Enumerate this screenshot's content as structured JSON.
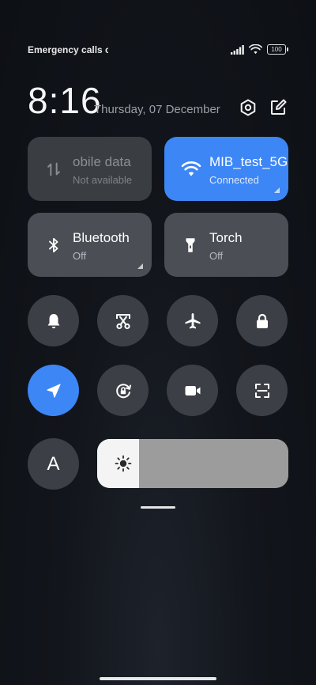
{
  "status_bar": {
    "carrier_text": "Emergency calls o",
    "battery_level": "100"
  },
  "header": {
    "time": "8:16",
    "date": "Thursday, 07 December"
  },
  "tiles": {
    "mobile_data": {
      "title": "obile data",
      "subtitle": "Not available",
      "active": false,
      "available": false
    },
    "wifi": {
      "title": "MIB_test_5G",
      "subtitle": "Connected",
      "active": true
    },
    "bluetooth": {
      "title": "Bluetooth",
      "subtitle": "Off",
      "active": false
    },
    "torch": {
      "title": "Torch",
      "subtitle": "Off",
      "active": false
    }
  },
  "toggles": [
    {
      "name": "notification-bell",
      "icon": "bell-icon",
      "active": false
    },
    {
      "name": "screenshot",
      "icon": "scissors-screenshot-icon",
      "active": false
    },
    {
      "name": "airplane-mode",
      "icon": "airplane-icon",
      "active": false
    },
    {
      "name": "lock-screen",
      "icon": "lock-icon",
      "active": false
    },
    {
      "name": "location",
      "icon": "location-arrow-icon",
      "active": true
    },
    {
      "name": "rotation-lock",
      "icon": "rotation-lock-icon",
      "active": false
    },
    {
      "name": "screen-recorder",
      "icon": "video-camera-icon",
      "active": false
    },
    {
      "name": "scanner",
      "icon": "scan-icon",
      "active": false
    }
  ],
  "auto_brightness": {
    "label": "A"
  },
  "brightness": {
    "level": 0.22,
    "icon": "sun-icon"
  },
  "colors": {
    "accent": "#3d86f5",
    "tile_inactive": "#4b4e54",
    "toggle_inactive": "#3c3f45",
    "slider_fill": "#f4f4f4",
    "slider_track": "#9c9c9c"
  }
}
